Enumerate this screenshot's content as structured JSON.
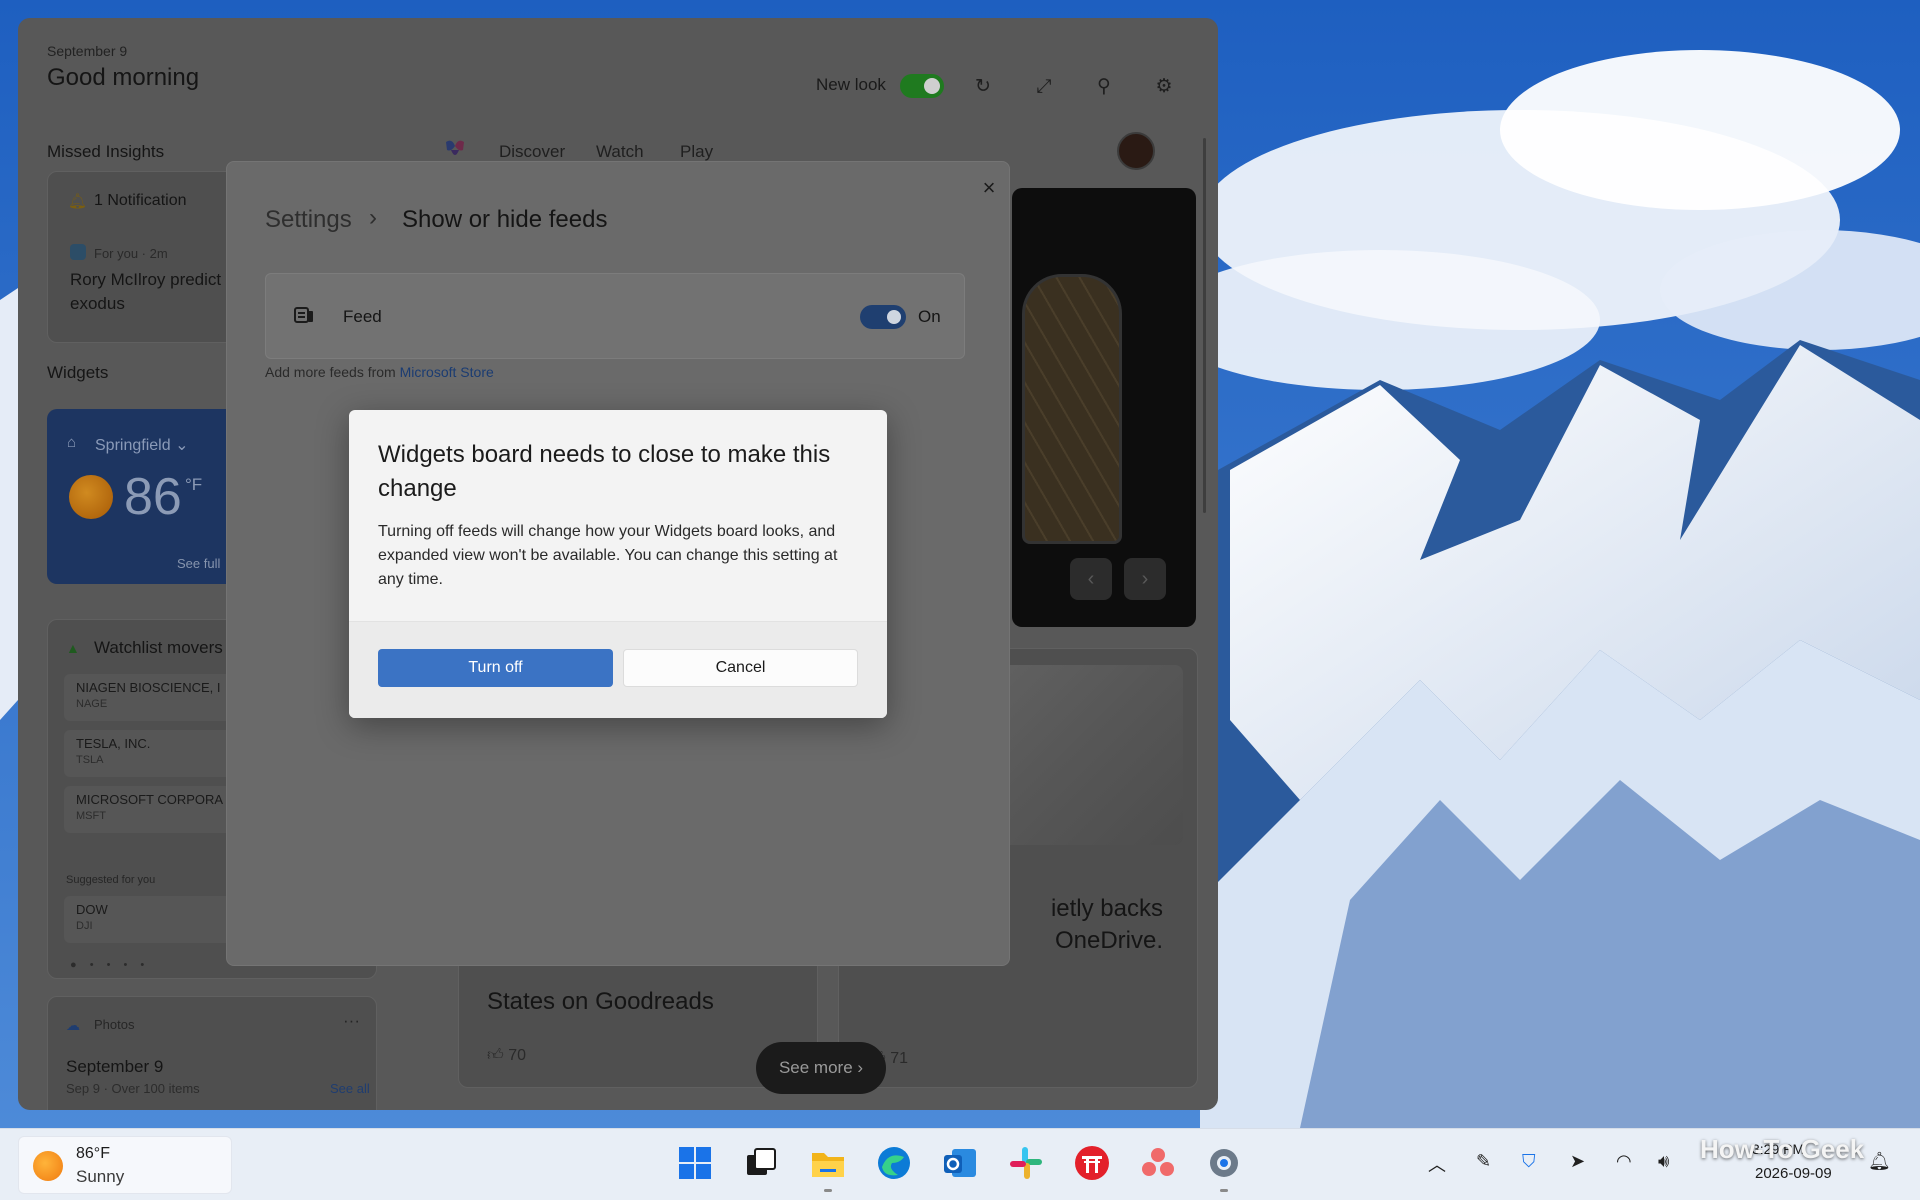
{
  "widgets": {
    "date": "September 9",
    "greeting": "Good morning",
    "new_look_label": "New look",
    "missed_insights": "Missed Insights",
    "tabs": [
      {
        "label": "Discover"
      },
      {
        "label": "Watch"
      },
      {
        "label": "Play"
      }
    ],
    "notification": {
      "title": "1 Notification",
      "source": "For you · 2m",
      "body": "Rory McIlroy predict exodus"
    },
    "widgets_label": "Widgets",
    "weather": {
      "location": "Springfield",
      "temp": "86",
      "unit": "°F",
      "see_full": "See full"
    },
    "watchlist": {
      "title": "Watchlist movers",
      "stocks": [
        {
          "name": "NIAGEN BIOSCIENCE, I",
          "ticker": "NAGE"
        },
        {
          "name": "TESLA, INC.",
          "ticker": "TSLA"
        },
        {
          "name": "MICROSOFT CORPORA",
          "ticker": "MSFT"
        }
      ],
      "suggested_label": "Suggested for you",
      "suggested": [
        {
          "name": "DOW",
          "ticker": "DJI"
        }
      ],
      "pager_dots": "● • • • •"
    },
    "photos": {
      "label": "Photos",
      "more": "···",
      "date": "September 9",
      "sub": "Sep 9 · Over 100 items",
      "see_all": "See all"
    },
    "articles": [
      {
        "title": "States on Goodreads",
        "likes": "70"
      },
      {
        "title": "ietly backs\n OneDrive.",
        "likes": "71"
      }
    ],
    "see_more": "See more"
  },
  "settings": {
    "breadcrumb_root": "Settings",
    "breadcrumb_page": "Show or hide feeds",
    "feed_label": "Feed",
    "feed_state": "On",
    "hint_prefix": "Add more feeds from ",
    "hint_link": "Microsoft Store"
  },
  "modal": {
    "title": "Widgets board needs to close to make this change",
    "body": "Turning off feeds will change how your Widgets board looks, and expanded view won't be available. You can change this setting at any time.",
    "primary_button": "Turn off",
    "secondary_button": "Cancel"
  },
  "taskbar": {
    "weather_temp": "86°F",
    "weather_desc": "Sunny",
    "clock_time": "3:29 PM",
    "clock_date": "2026-09-09",
    "apps": [
      "start-icon",
      "task-view-icon",
      "file-explorer-icon",
      "edge-icon",
      "outlook-icon",
      "slack-icon",
      "torii-app-icon",
      "asana-icon",
      "settings-icon"
    ],
    "watermark": "How-To Geek"
  },
  "colors": {
    "accent": "#3b73c4",
    "toggle_on_green": "#1f7a1f",
    "dim_overlay": "#585858"
  }
}
